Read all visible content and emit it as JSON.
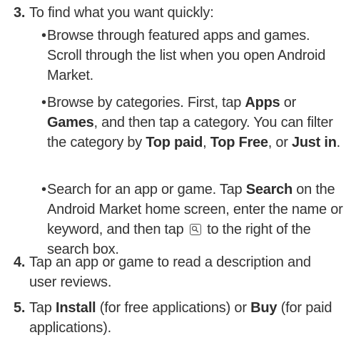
{
  "steps": {
    "s3": {
      "num": "3.",
      "text": "To find what you want quickly:"
    },
    "s4": {
      "num": "4.",
      "text": "Tap an app or game to read a description and user reviews."
    },
    "s5": {
      "num": "5.",
      "text_1": "Tap ",
      "bold_install": "Install",
      "text_2": " (for free applications) or ",
      "bold_buy": "Buy",
      "text_3": " (for paid applications)."
    }
  },
  "bullets": {
    "b1": {
      "dot": "•",
      "text": "Browse through featured apps and games. Scroll through the list when you open Android Market."
    },
    "b2": {
      "dot": "•",
      "text_1": "Browse by categories. First, tap ",
      "bold_apps": "Apps",
      "text_2": " or ",
      "bold_games": "Games",
      "text_3": ", and then tap a category. You can filter the category by ",
      "bold_top_paid": "Top paid",
      "text_4": ", ",
      "bold_top_free": "Top Free",
      "text_5": ", or ",
      "bold_just_in": "Just in",
      "text_6": "."
    },
    "b3": {
      "dot": "•",
      "text_1": "Search for an app or game. Tap ",
      "bold_search": "Search",
      "text_2": " on the Android Market home screen, enter the name or keyword, and then tap ",
      "icon": "search-icon",
      "text_3": " to the right of the search box."
    }
  }
}
